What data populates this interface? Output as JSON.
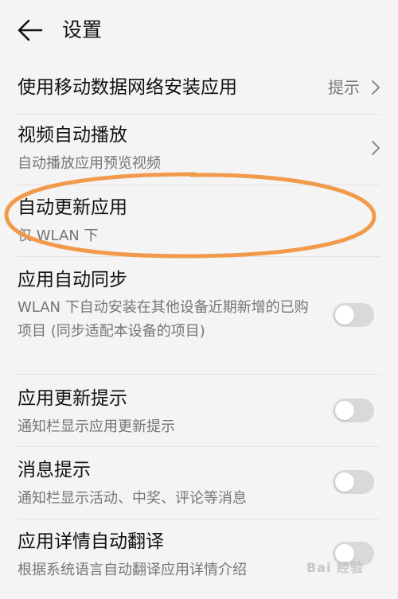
{
  "colors": {
    "background": "#f4f4f4",
    "text_primary": "#111111",
    "text_secondary": "#757575",
    "divider": "#e2e2e2",
    "toggle_off": "#d9d9d9",
    "highlight": "#f29a4c"
  },
  "header": {
    "back_icon": "arrow-left-icon",
    "title": "设置"
  },
  "settings": [
    {
      "title": "使用移动数据网络安装应用",
      "trailing_text": "提示",
      "trailing_icon": "chevron-right-icon"
    },
    {
      "title": "视频自动播放",
      "subtitle": "自动播放应用预览视频",
      "trailing_icon": "chevron-right-icon"
    },
    {
      "title": "自动更新应用",
      "subtitle": "仅 WLAN 下",
      "highlighted": true
    },
    {
      "title": "应用自动同步",
      "subtitle": "WLAN 下自动安装在其他设备近期新增的已购项目 (同步适配本设备的项目)",
      "toggle": false
    },
    {
      "title": "应用更新提示",
      "subtitle": "通知栏显示应用更新提示",
      "toggle": false
    },
    {
      "title": "消息提示",
      "subtitle": "通知栏显示活动、中奖、评论等消息",
      "toggle": false
    },
    {
      "title": "应用详情自动翻译",
      "subtitle": "根据系统语言自动翻译应用详情介绍",
      "toggle": false
    }
  ],
  "watermark": {
    "text": "Bai 经验"
  }
}
